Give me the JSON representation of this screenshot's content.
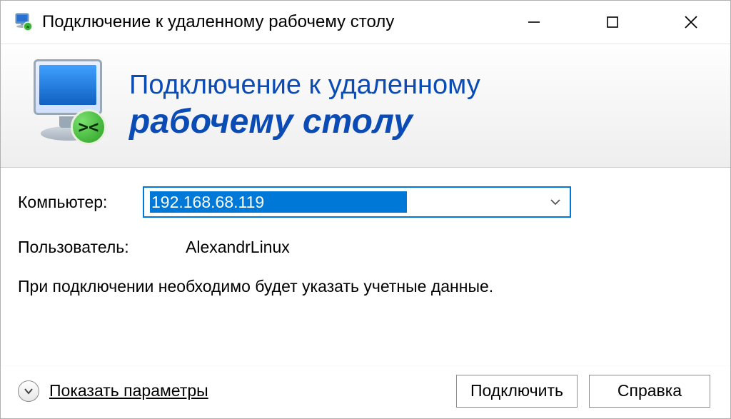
{
  "titlebar": {
    "title": "Подключение к удаленному рабочему столу",
    "icon": "rdp-icon"
  },
  "banner": {
    "line1": "Подключение к удаленному",
    "line2": "рабочему столу"
  },
  "form": {
    "computer_label": "Компьютер:",
    "computer_value": "192.168.68.119",
    "user_label": "Пользователь:",
    "user_value": "AlexandrLinux",
    "info_text": "При подключении необходимо будет указать учетные данные."
  },
  "footer": {
    "expand_label": "Показать параметры",
    "connect_label": "Подключить",
    "help_label": "Справка"
  }
}
